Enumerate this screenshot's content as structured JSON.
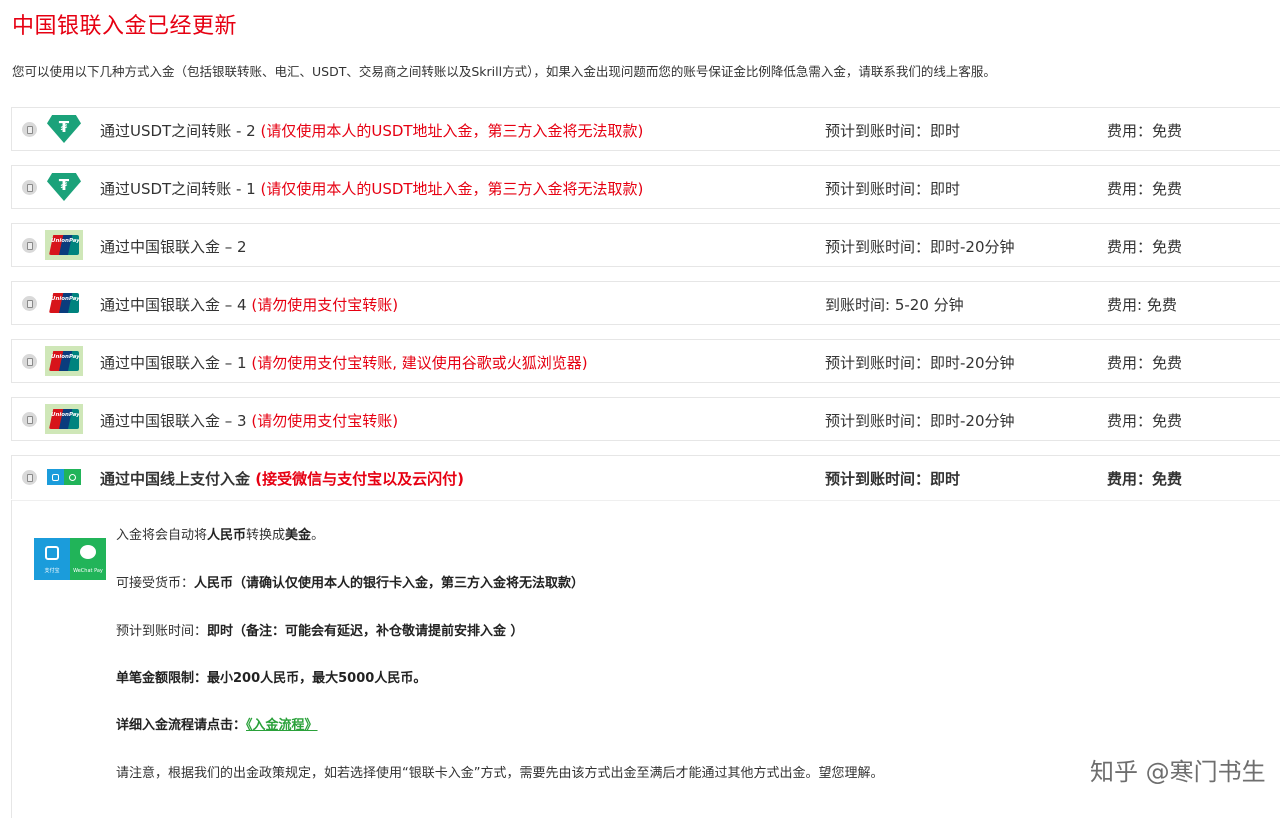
{
  "page": {
    "title": "中国银联入金已经更新",
    "intro": "您可以使用以下几种方式入金（包括银联转账、电汇、USDT、交易商之间转账以及Skrill方式），如果入金出现问题而您的账号保证金比例降低急需入金，请联系我们的线上客服。"
  },
  "methods": [
    {
      "icon": "tether-icon",
      "name": "通过USDT之间转账 - 2 ",
      "note": "(请仅使用本人的USDT地址入金，第三方入金将无法取款)",
      "time": "预计到账时间：即时",
      "fee": "费用：免费"
    },
    {
      "icon": "tether-icon",
      "name": "通过USDT之间转账 - 1 ",
      "note": "(请仅使用本人的USDT地址入金，第三方入金将无法取款)",
      "time": "预计到账时间：即时",
      "fee": "费用：免费"
    },
    {
      "icon": "unionpay-icon",
      "name": "通过中国银联入金 – 2",
      "note": "",
      "time": "预计到账时间：即时-20分钟",
      "fee": "费用：免费"
    },
    {
      "icon": "unionpay-icon",
      "name": "通过中国银联入金 – 4 ",
      "note": "(请勿使用支付宝转账)",
      "time": "到账时间: 5-20 分钟",
      "fee": "费用: 免费"
    },
    {
      "icon": "unionpay-icon",
      "name": "通过中国银联入金 – 1 ",
      "note": "(请勿使用支付宝转账, 建议使用谷歌或火狐浏览器)",
      "time": "预计到账时间：即时-20分钟",
      "fee": "费用：免费"
    },
    {
      "icon": "unionpay-icon",
      "name": "通过中国银联入金 – 3 ",
      "note": "(请勿使用支付宝转账)",
      "time": "预计到账时间：即时-20分钟",
      "fee": "费用：免费"
    },
    {
      "icon": "alipay-wechat-icon",
      "name": "通过中国线上支付入金 ",
      "note": "(接受微信与支付宝以及云闪付)",
      "time": "预计到账时间：即时",
      "fee": "费用：免费"
    }
  ],
  "detail": {
    "logo_caption_left": "支付宝",
    "logo_caption_right": "WeChat Pay",
    "line1_a": "入金将会自动将",
    "line1_b": "人民币",
    "line1_c": "转换成",
    "line1_d": "美金",
    "line1_e": "。",
    "line2_label": "可接受货币：",
    "line2_value": "人民币（请确认仅使用本人的银行卡入金，第三方入金将无法取款）",
    "line3_label": "预计到账时间：",
    "line3_value": "即时（备注：可能会有延迟，补仓敬请提前安排入金 ）",
    "line4": "单笔金额限制：最小200人民币，最大5000人民币。",
    "line5_label": "详细入金流程请点击：",
    "line5_link": "《入金流程》",
    "line6": "请注意，根据我们的出金政策规定，如若选择使用“银联卡入金”方式，需要先由该方式出金至满后才能通过其他方式出金。望您理解。"
  },
  "watermark": "知乎 @寒门书生",
  "colors": {
    "accent_red": "#e60012",
    "link_green": "#2aa13a",
    "tether_green": "#1ba27a",
    "alipay_blue": "#1b9cdb",
    "wechat_green": "#21b459"
  }
}
